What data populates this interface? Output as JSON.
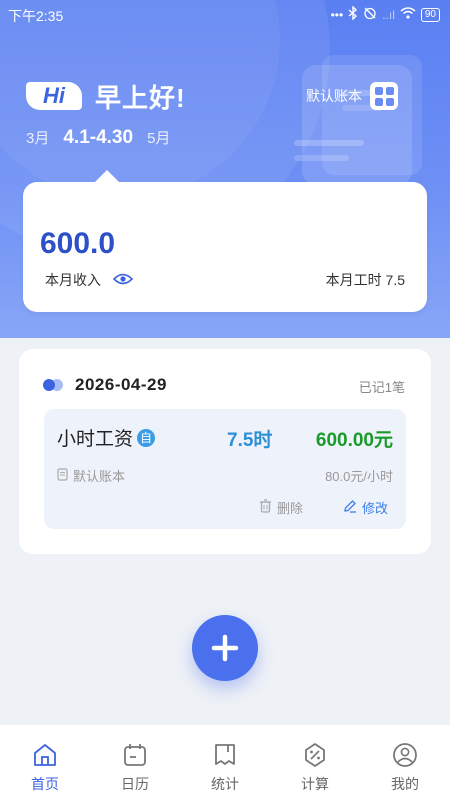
{
  "status_bar": {
    "time": "下午2:35",
    "battery": "90",
    "network": "..ıl"
  },
  "header": {
    "hi_badge": "Hi",
    "greeting": "早上好!",
    "prev_month": "3月",
    "current_range": "4.1-4.30",
    "next_month": "5月",
    "account_name": "默认账本"
  },
  "summary": {
    "income_amount": "600.0",
    "income_label": "本月收入",
    "work_hours_label": "本月工时 7.5"
  },
  "day": {
    "date": "2026-04-29",
    "count_label": "已记1笔",
    "entries": [
      {
        "type": "小时工资",
        "auto_badge": "自",
        "hours": "7.5时",
        "amount": "600.00元",
        "account": "默认账本",
        "rate": "80.0元/小时",
        "delete_label": "删除",
        "edit_label": "修改"
      }
    ]
  },
  "tabs": [
    {
      "label": "首页",
      "icon": "home-icon",
      "active": true
    },
    {
      "label": "日历",
      "icon": "calendar-icon",
      "active": false
    },
    {
      "label": "统计",
      "icon": "statistics-icon",
      "active": false
    },
    {
      "label": "计算",
      "icon": "calculator-icon",
      "active": false
    },
    {
      "label": "我的",
      "icon": "profile-icon",
      "active": false
    }
  ],
  "colors": {
    "primary": "#4a70ee",
    "income_blue": "#2d4fc8",
    "hours_blue": "#2d8fd6",
    "amount_green": "#1a9a2a"
  }
}
